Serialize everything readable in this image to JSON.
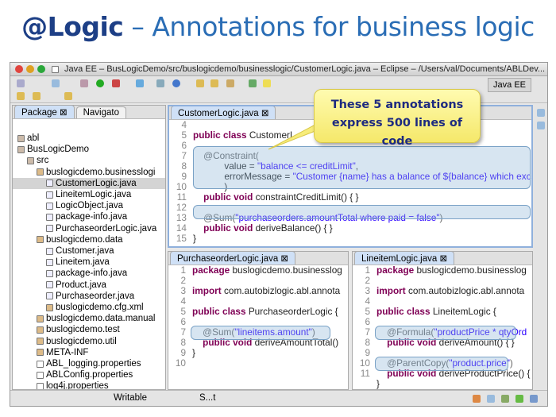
{
  "slide": {
    "title_bold": "@Logic",
    "title_rest": " – Annotations for business logic"
  },
  "window": {
    "title": "Java EE – BusLogicDemo/src/buslogicdemo/businesslogic/CustomerLogic.java – Eclipse – /Users/val/Documents/ABLDev..."
  },
  "toolbar": {
    "perspective": "Java EE"
  },
  "left_panel": {
    "tabs": [
      "Package",
      "Navigato"
    ],
    "tree": [
      {
        "label": "abl",
        "depth": 0
      },
      {
        "label": "BusLogicDemo",
        "depth": 0
      },
      {
        "label": "src",
        "depth": 1
      },
      {
        "label": "buslogicdemo.businesslogi",
        "depth": 2
      },
      {
        "label": "CustomerLogic.java",
        "depth": 3,
        "selected": true
      },
      {
        "label": "LineitemLogic.java",
        "depth": 3
      },
      {
        "label": "LogicObject.java",
        "depth": 3
      },
      {
        "label": "package-info.java",
        "depth": 3
      },
      {
        "label": "PurchaseorderLogic.java",
        "depth": 3
      },
      {
        "label": "buslogicdemo.data",
        "depth": 2
      },
      {
        "label": "Customer.java",
        "depth": 3
      },
      {
        "label": "Lineitem.java",
        "depth": 3
      },
      {
        "label": "package-info.java",
        "depth": 3
      },
      {
        "label": "Product.java",
        "depth": 3
      },
      {
        "label": "Purchaseorder.java",
        "depth": 3
      },
      {
        "label": "buslogicdemo.cfg.xml",
        "depth": 3
      },
      {
        "label": "buslogicdemo.data.manual",
        "depth": 2
      },
      {
        "label": "buslogicdemo.test",
        "depth": 2
      },
      {
        "label": "buslogicdemo.util",
        "depth": 2
      },
      {
        "label": "META-INF",
        "depth": 2
      },
      {
        "label": "ABL_logging.properties",
        "depth": 2
      },
      {
        "label": "ABLConfig.properties",
        "depth": 2
      },
      {
        "label": "log4j.properties",
        "depth": 2
      }
    ]
  },
  "editors": [
    {
      "tab": "CustomerLogic.java",
      "lines": [
        [
          "4",
          []
        ],
        [
          "5",
          [
            [
              "kw",
              "public class "
            ],
            [
              "pl",
              "CustomerL"
            ]
          ]
        ],
        [
          "6",
          []
        ],
        [
          "7",
          [
            [
              "an",
              "    @Constraint("
            ]
          ]
        ],
        [
          "8",
          [
            [
              "pl",
              "            value = "
            ],
            [
              "st",
              "\"balance <= creditLimit\""
            ],
            [
              "pl",
              ","
            ]
          ]
        ],
        [
          "9",
          [
            [
              "pl",
              "            errorMessage = "
            ],
            [
              "st",
              "\"Customer {name} has a balance of ${balance} which exc"
            ]
          ]
        ],
        [
          "10",
          [
            [
              "pl",
              "            )"
            ]
          ]
        ],
        [
          "11",
          [
            [
              "kw",
              "    public void "
            ],
            [
              "pl",
              "constraintCreditLimit() { }"
            ]
          ]
        ],
        [
          "12",
          []
        ],
        [
          "13",
          [
            [
              "an",
              "    @Sum("
            ],
            [
              "st",
              "\"purchaseorders.amountTotal where paid = false\""
            ],
            [
              "an",
              ")"
            ]
          ]
        ],
        [
          "14",
          [
            [
              "kw",
              "    public void "
            ],
            [
              "pl",
              "deriveBalance() { }"
            ]
          ]
        ],
        [
          "15",
          [
            [
              "pl",
              "}"
            ]
          ]
        ]
      ]
    },
    {
      "tab": "PurchaseorderLogic.java",
      "lines": [
        [
          "1",
          [
            [
              "kw",
              "package "
            ],
            [
              "pl",
              "buslogicdemo.businesslog"
            ]
          ]
        ],
        [
          "2",
          []
        ],
        [
          "3",
          [
            [
              "kw",
              "import "
            ],
            [
              "pl",
              "com.autobizlogic.abl.annota"
            ]
          ]
        ],
        [
          "4",
          []
        ],
        [
          "5",
          [
            [
              "kw",
              "public class "
            ],
            [
              "pl",
              "PurchaseorderLogic {"
            ]
          ]
        ],
        [
          "6",
          []
        ],
        [
          "7",
          [
            [
              "an",
              "    @Sum("
            ],
            [
              "st",
              "\"lineitems.amount\""
            ],
            [
              "an",
              ")"
            ]
          ]
        ],
        [
          "8",
          [
            [
              "kw",
              "    public void "
            ],
            [
              "pl",
              "deriveAmountTotal()"
            ]
          ]
        ],
        [
          "9",
          [
            [
              "pl",
              "}"
            ]
          ]
        ],
        [
          "10",
          []
        ]
      ]
    },
    {
      "tab": "LineitemLogic.java",
      "lines": [
        [
          "1",
          [
            [
              "kw",
              "package "
            ],
            [
              "pl",
              "buslogicdemo.businesslog"
            ]
          ]
        ],
        [
          "2",
          []
        ],
        [
          "3",
          [
            [
              "kw",
              "import "
            ],
            [
              "pl",
              "com.autobizlogic.abl.annota"
            ]
          ]
        ],
        [
          "4",
          []
        ],
        [
          "5",
          [
            [
              "kw",
              "public class "
            ],
            [
              "pl",
              "LineitemLogic {"
            ]
          ]
        ],
        [
          "6",
          []
        ],
        [
          "7",
          [
            [
              "an",
              "    @Formula("
            ],
            [
              "st",
              "\"productPrice * qtyOrd"
            ]
          ]
        ],
        [
          "8",
          [
            [
              "kw",
              "    public void "
            ],
            [
              "pl",
              "deriveAmount() { }"
            ]
          ]
        ],
        [
          "9",
          []
        ],
        [
          "10",
          [
            [
              "an",
              "    @ParentCopy("
            ],
            [
              "st",
              "\"product.price\""
            ],
            [
              "an",
              ")"
            ]
          ]
        ],
        [
          "11",
          [
            [
              "kw",
              "    public void "
            ],
            [
              "pl",
              "deriveProductPrice() {"
            ]
          ]
        ],
        [
          "",
          [
            [
              "pl",
              "}"
            ]
          ]
        ]
      ]
    }
  ],
  "status": {
    "writable": "Writable",
    "insert": "S...t"
  },
  "callout": {
    "line1": "These 5 annotations",
    "line2": "express 500 lines of code"
  }
}
